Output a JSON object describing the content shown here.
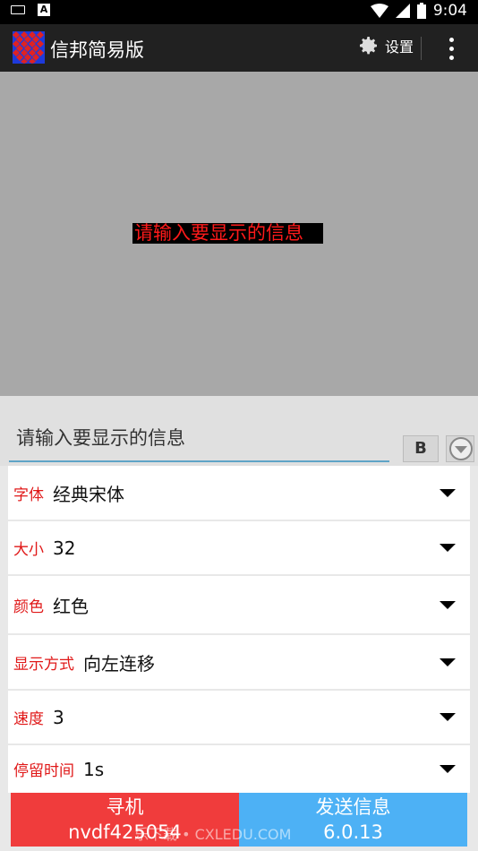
{
  "status": {
    "time": "9:04"
  },
  "app": {
    "title": "信邦简易版",
    "settings_label": "设置"
  },
  "preview": {
    "text": "请输入要显示的信息"
  },
  "input": {
    "value": "请输入要显示的信息",
    "bold_label": "B"
  },
  "settings": [
    {
      "label": "字体",
      "value": "经典宋体"
    },
    {
      "label": "大小",
      "value": "32"
    },
    {
      "label": "颜色",
      "value": "红色"
    },
    {
      "label": "显示方式",
      "value": "向左连移"
    },
    {
      "label": "速度",
      "value": "3"
    },
    {
      "label": "停留时间",
      "value": "1s"
    }
  ],
  "bottom": {
    "search_label": "寻机",
    "device_id": "nvdf425054",
    "send_label": "发送信息",
    "version": "6.0.13"
  },
  "watermark": "乐下载 • CXLEDU.COM",
  "colors": {
    "label_red": "#e01818",
    "search_btn": "#f03c3c",
    "send_btn": "#4db1f5",
    "appbar": "#212121"
  }
}
